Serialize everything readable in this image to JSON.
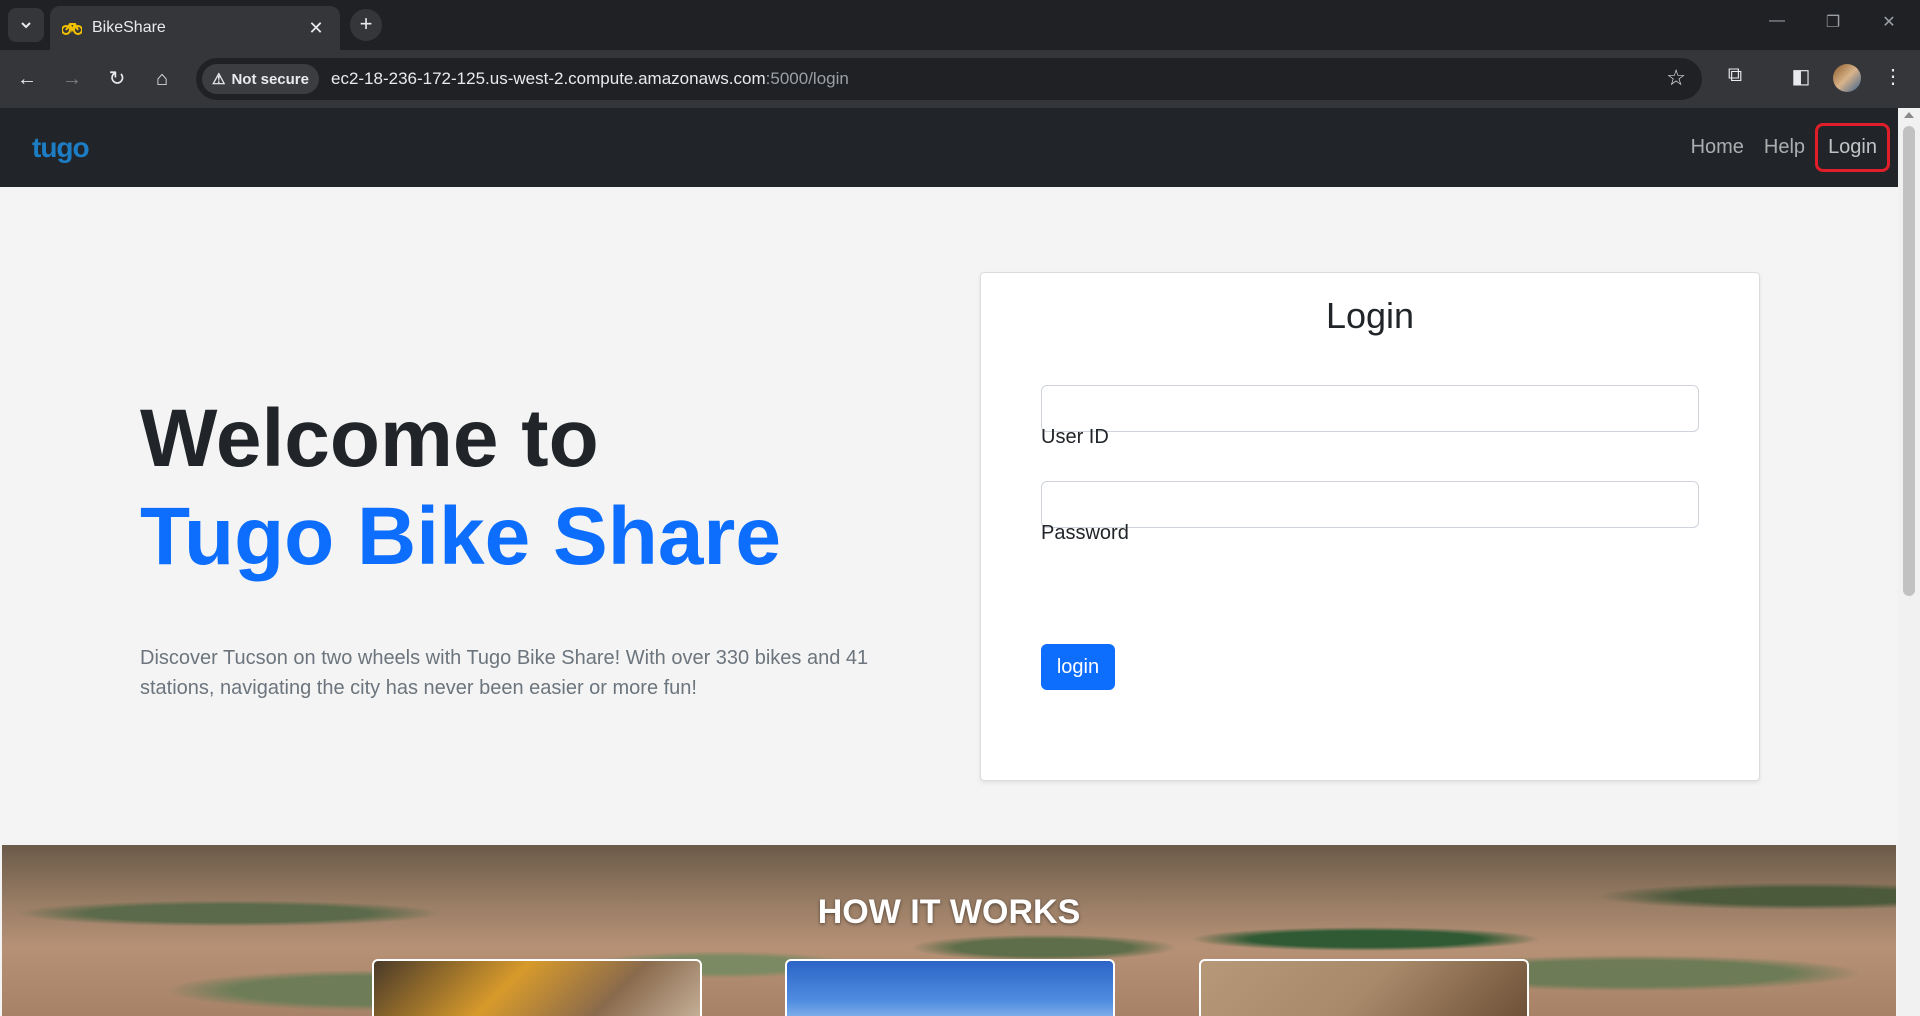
{
  "browser": {
    "tab_title": "BikeShare",
    "security_label": "Not secure",
    "url_host": "ec2-18-236-172-125.us-west-2.compute.amazonaws.com",
    "url_path": ":5000/login"
  },
  "nav": {
    "logo_text": "tugo",
    "links": [
      "Home",
      "Help",
      "Login"
    ]
  },
  "hero": {
    "line1": "Welcome to",
    "line2": "Tugo Bike Share",
    "description": "Discover Tucson on two wheels with Tugo Bike Share! With over 330 bikes and 41 stations, navigating the city has never been easier or more fun!"
  },
  "login": {
    "title": "Login",
    "user_id_label": "User ID",
    "user_id_value": "",
    "password_label": "Password",
    "password_value": "",
    "button_label": "login"
  },
  "how": {
    "title": "HOW IT WORKS"
  },
  "colors": {
    "brand_blue": "#0d6efd",
    "navbar": "#212529",
    "highlight_box": "#e01e2a"
  }
}
